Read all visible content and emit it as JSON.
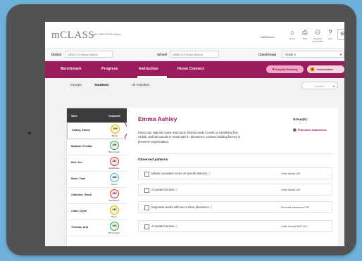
{
  "app": {
    "brand": "mCLASS",
    "brand_sub": "with DIBELS® 8th Edition",
    "user_name": "Julia Benson",
    "header_buttons": [
      {
        "icon": "home-icon",
        "label": "Home"
      },
      {
        "icon": "print-icon",
        "label": "Print"
      },
      {
        "icon": "people-icon",
        "label": "Progress and Growth"
      },
      {
        "icon": "help-icon",
        "label": "Help"
      }
    ]
  },
  "filters": {
    "district_label": "District",
    "district_value": "DIBELS 8 Demo District",
    "school_label": "School",
    "school_value": "DIBELS 8 Demo School",
    "class_label": "Class/Group",
    "class_value": "Grade 1"
  },
  "nav": {
    "items": [
      "Benchmark",
      "Progress",
      "Instruction",
      "Home Connect"
    ],
    "active": "Instruction",
    "amplify_label": "Amplify Reading",
    "intervention_label": "Intervention"
  },
  "tabs": {
    "items": [
      "Groups",
      "Students",
      "All Activities"
    ],
    "active": "Students",
    "grade_select": "Grade 1"
  },
  "student_list": {
    "col_name": "Name",
    "col_composite": "Composite",
    "students": [
      {
        "name": "Ashley, Emma",
        "score": "309",
        "level": "Below",
        "status": "below"
      },
      {
        "name": "Baldwin, Freddie",
        "score": "345",
        "level": "Benchmark",
        "status": "bench"
      },
      {
        "name": "Bell, Jon",
        "score": "287",
        "level": "Well Below",
        "status": "well"
      },
      {
        "name": "Bush, Tami",
        "score": "380",
        "level": "Above",
        "status": "above"
      },
      {
        "name": "Chandler, Verna",
        "score": "263",
        "level": "Well Below",
        "status": "well"
      },
      {
        "name": "Cobb, Clyde",
        "score": "320",
        "level": "Below",
        "status": "below"
      },
      {
        "name": "Thomas, Aria",
        "score": "340",
        "level": "Benchmark",
        "status": "bench"
      }
    ],
    "selected_index": 0
  },
  "detail": {
    "name": "Emma Ashley",
    "description": "Emma can segment some word parts. Emma needs to work on identifying first, middle, and last sounds in words with 3+ phonemes; continue building fluency in phoneme segmentation.",
    "groups_title": "Group(s):",
    "group_name": "Phonemic Awareness",
    "observed_title": "Observed patterns",
    "patterns": [
      {
        "text": "Makes consistent errors on specific letter(s) ⓘ",
        "skill": "Letter Names  LNF"
      },
      {
        "text": "Accurate but slow ⓘ",
        "skill": "Letter Names  LNF"
      },
      {
        "text": "Segments words with two to three phonemes ⓘ",
        "skill": "Phonemic Awareness  PSF"
      },
      {
        "text": "Accurate but slow ⓘ",
        "skill": "Letter Sounds  NWF-CLS"
      }
    ]
  }
}
